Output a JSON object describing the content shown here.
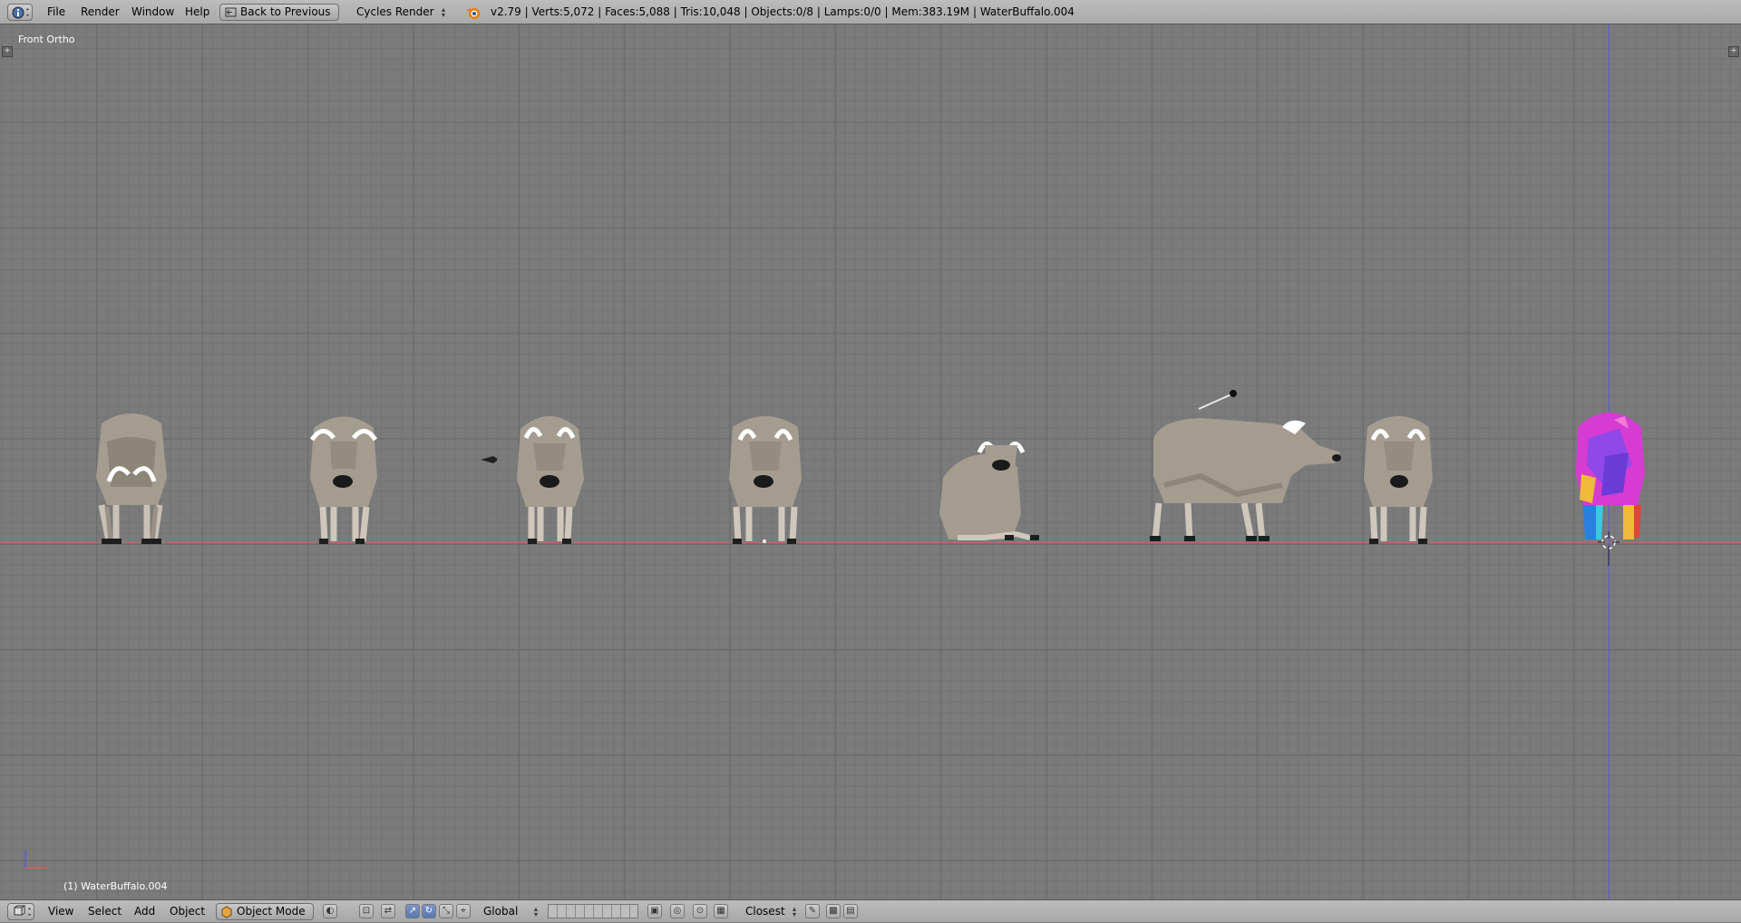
{
  "header": {
    "menus": [
      {
        "id": "file",
        "label": "File"
      },
      {
        "id": "render",
        "label": "Render"
      },
      {
        "id": "window",
        "label": "Window"
      },
      {
        "id": "help",
        "label": "Help"
      }
    ],
    "back_button": "Back to Previous",
    "render_engine": "Cycles Render",
    "stats": "v2.79 | Verts:5,072 | Faces:5,088 | Tris:10,048 | Objects:0/8 | Lamps:0/0 | Mem:383.19M | WaterBuffalo.004"
  },
  "viewport": {
    "view_name": "Front Ortho",
    "active_object": "(1) WaterBuffalo.004",
    "creature_color": "#a59c90",
    "selected_object_colors": [
      "#d63bd2",
      "#8f49e8",
      "#2b7fe0",
      "#f0b93a"
    ]
  },
  "footer": {
    "menus": [
      {
        "id": "view",
        "label": "View"
      },
      {
        "id": "select",
        "label": "Select"
      },
      {
        "id": "add",
        "label": "Add"
      },
      {
        "id": "object",
        "label": "Object"
      }
    ],
    "mode": "Object Mode",
    "orientation": "Global",
    "snap_target": "Closest"
  }
}
